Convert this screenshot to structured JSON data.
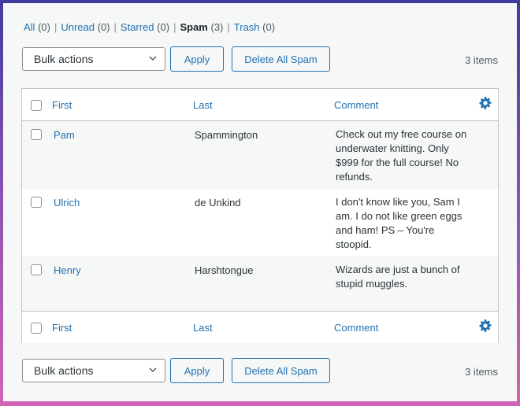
{
  "views": [
    {
      "label": "All",
      "count": "(0)",
      "current": false
    },
    {
      "label": "Unread",
      "count": "(0)",
      "current": false
    },
    {
      "label": "Starred",
      "count": "(0)",
      "current": false
    },
    {
      "label": "Spam",
      "count": "(3)",
      "current": true
    },
    {
      "label": "Trash",
      "count": "(0)",
      "current": false
    }
  ],
  "separator": "|",
  "top_nav": {
    "bulk_actions": "Bulk actions",
    "apply": "Apply",
    "delete_all_spam": "Delete All Spam",
    "items_count": "3 items"
  },
  "bottom_nav": {
    "bulk_actions": "Bulk actions",
    "apply": "Apply",
    "delete_all_spam": "Delete All Spam",
    "items_count": "3 items"
  },
  "columns": {
    "first": "First",
    "last": "Last",
    "comment": "Comment"
  },
  "rows": [
    {
      "first": "Pam",
      "last": "Spammington",
      "comment": "Check out my free course on underwater knitting. Only $999 for the full course! No refunds."
    },
    {
      "first": "Ulrich",
      "last": "de Unkind",
      "comment": "I don't know like you, Sam I am. I do not like green eggs and ham! PS – You're stoopid."
    },
    {
      "first": "Henry",
      "last": "Harshtongue",
      "comment": "Wizards are just a bunch of stupid muggles."
    }
  ],
  "colors": {
    "link": "#2271b1",
    "text": "#1d2327",
    "border": "#c3c4c7"
  },
  "icons": [
    "chevron-down-icon",
    "gear-icon",
    "checkbox"
  ]
}
